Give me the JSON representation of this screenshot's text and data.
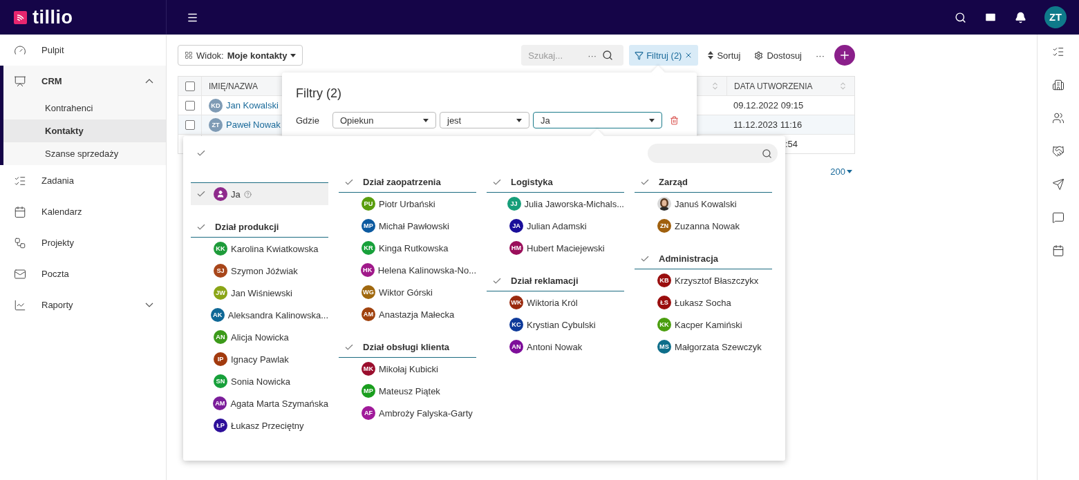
{
  "topbar": {
    "logo": "tillio",
    "user_initials": "ZT"
  },
  "sidebar": {
    "items": [
      {
        "label": "Pulpit"
      },
      {
        "label": "CRM",
        "expanded": true,
        "children": [
          {
            "label": "Kontrahenci",
            "selected": false
          },
          {
            "label": "Kontakty",
            "selected": true
          },
          {
            "label": "Szanse sprzedaży",
            "selected": false
          }
        ]
      },
      {
        "label": "Zadania"
      },
      {
        "label": "Kalendarz"
      },
      {
        "label": "Projekty"
      },
      {
        "label": "Poczta"
      },
      {
        "label": "Raporty",
        "expanded": false
      }
    ]
  },
  "toolbar": {
    "view_label": "Widok:",
    "view_value": "Moje kontakty",
    "search_placeholder": "Szukaj...",
    "more": "···",
    "filter": "Filtruj (2)",
    "sort": "Sortuj",
    "customize": "Dostosuj",
    "more_actions": "···"
  },
  "table": {
    "columns": [
      "IMIĘ/NAZWA",
      "DATA UTWORZENIA"
    ],
    "all_checked": false,
    "rows": [
      {
        "kind": "full",
        "initials": "KD",
        "name": "Jan Kowalski",
        "date": "09.12.2022 09:15",
        "highlighted": false,
        "checked": false
      },
      {
        "kind": "full",
        "initials": "ZT",
        "name": "Paweł Nowak",
        "date": "11.12.2023 11:16",
        "highlighted": true,
        "checked": false
      },
      {
        "kind": "partial",
        "date": ":54"
      }
    ]
  },
  "pagination": {
    "page_size": "200"
  },
  "filter_panel": {
    "title": "Filtry (2)",
    "rows": [
      {
        "label": "Gdzie",
        "field": "Opiekun",
        "operator": "jest",
        "value": "Ja"
      }
    ]
  },
  "dropdown": {
    "columns": [
      [
        {
          "items": [
            {
              "kind": "self",
              "name": "Ja",
              "selected": true,
              "color": "#8e2a8c"
            }
          ]
        },
        {
          "title": "Dział produkcji",
          "items": [
            {
              "initials": "KK",
              "name": "Karolina Kwiatkowska",
              "color": "#1e9b3a",
              "selected": false
            },
            {
              "initials": "SJ",
              "name": "Szymon Jóźwiak",
              "color": "#a8461a",
              "selected": false
            },
            {
              "initials": "JW",
              "name": "Jan Wiśniewski",
              "color": "#8aa516",
              "selected": false
            },
            {
              "initials": "AK",
              "name": "Aleksandra Kalinowska...",
              "color": "#0f6896",
              "selected": false
            },
            {
              "initials": "AN",
              "name": "Alicja Nowicka",
              "color": "#3c9a1a",
              "selected": false
            },
            {
              "initials": "IP",
              "name": "Ignacy Pawlak",
              "color": "#a23a0e",
              "selected": false
            },
            {
              "initials": "SN",
              "name": "Sonia Nowicka",
              "color": "#17a03a",
              "selected": false
            },
            {
              "initials": "AM",
              "name": "Agata Marta Szymańska",
              "color": "#7b1d9a",
              "selected": false
            },
            {
              "initials": "ŁP",
              "name": "Łukasz Przeciętny",
              "color": "#2d0f9a",
              "selected": false
            }
          ]
        }
      ],
      [
        {
          "title": "Dział zaopatrzenia",
          "items": [
            {
              "initials": "PU",
              "name": "Piotr Urbański",
              "color": "#5a9e0e",
              "selected": false
            },
            {
              "initials": "MP",
              "name": "Michał Pawłowski",
              "color": "#0c5aa0",
              "selected": false
            },
            {
              "initials": "KR",
              "name": "Kinga Rutkowska",
              "color": "#17a03a",
              "selected": false
            },
            {
              "initials": "HK",
              "name": "Helena Kalinowska-No...",
              "color": "#a0198a",
              "selected": false
            },
            {
              "initials": "WG",
              "name": "Wiktor Górski",
              "color": "#a0680e",
              "selected": false
            },
            {
              "initials": "AM",
              "name": "Anastazja Małecka",
              "color": "#a0420e",
              "selected": false
            }
          ]
        },
        {
          "title": "Dział obsługi klienta",
          "items": [
            {
              "initials": "MK",
              "name": "Mikołaj Kubicki",
              "color": "#9a0e2d",
              "selected": false
            },
            {
              "initials": "MP",
              "name": "Mateusz Piątek",
              "color": "#1a9e1e",
              "selected": false
            },
            {
              "initials": "AF",
              "name": "Ambroży Falyska-Garty",
              "color": "#a01a9a",
              "selected": false
            }
          ]
        }
      ],
      [
        {
          "title": "Logistyka",
          "items": [
            {
              "initials": "JJ",
              "name": "Julia Jaworska-Michals...",
              "color": "#179e7a",
              "selected": false
            },
            {
              "initials": "JA",
              "name": "Julian Adamski",
              "color": "#1a0e9a",
              "selected": false
            },
            {
              "initials": "HM",
              "name": "Hubert Maciejewski",
              "color": "#9a0e5a",
              "selected": false
            }
          ]
        },
        {
          "title": "Dział reklamacji",
          "items": [
            {
              "initials": "WK",
              "name": "Wiktoria Król",
              "color": "#9a2a0e",
              "selected": false
            },
            {
              "initials": "KC",
              "name": "Krystian Cybulski",
              "color": "#0e3a9a",
              "selected": false
            },
            {
              "initials": "AN",
              "name": "Antoni Nowak",
              "color": "#7e0e9a",
              "selected": false
            }
          ]
        }
      ],
      [
        {
          "title": "Zarząd",
          "items": [
            {
              "name": "Januś Kowalski",
              "selected": false
            },
            {
              "initials": "ZN",
              "name": "Zuzanna Nowak",
              "color": "#a0600e",
              "selected": false
            }
          ]
        },
        {
          "title": "Administracja",
          "items": [
            {
              "initials": "KB",
              "name": "Krzysztof Błaszczykx",
              "color": "#9a0e0e",
              "selected": false
            },
            {
              "initials": "ŁS",
              "name": "Łukasz Socha",
              "color": "#9a0e0e",
              "selected": false
            },
            {
              "initials": "KK",
              "name": "Kacper Kamiński",
              "color": "#4a9e0e",
              "selected": false
            },
            {
              "initials": "MS",
              "name": "Małgorzata Szewczyk",
              "color": "#0e6e8a",
              "selected": false
            }
          ]
        }
      ]
    ]
  }
}
